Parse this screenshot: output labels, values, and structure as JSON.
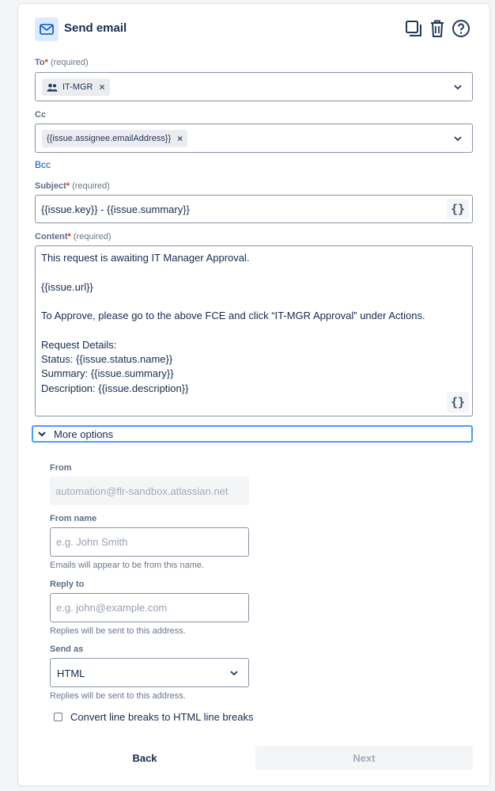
{
  "header": {
    "title": "Send email"
  },
  "icons": [
    "mail-icon",
    "duplicate-icon",
    "trash-icon",
    "help-icon",
    "people-icon",
    "chevron-down-icon",
    "smart-values-icon",
    "checkbox-icon"
  ],
  "to": {
    "label": "To",
    "required_text": "(required)",
    "tag": "IT-MGR",
    "remove": "×"
  },
  "cc": {
    "label": "Cc",
    "tag": "{{issue.assignee.emailAddress}}",
    "remove": "×"
  },
  "bcc_link": "Bcc",
  "subject": {
    "label": "Subject",
    "required_text": "(required)",
    "value": "{{issue.key}} - {{issue.summary}}",
    "smart_btn": "{}"
  },
  "content": {
    "label": "Content",
    "required_text": "(required)",
    "value": "This request is awaiting IT Manager Approval.\n\n{{issue.url}}\n\nTo Approve, please go to the above FCE and click “IT-MGR Approval” under Actions.\n\nRequest Details:\nStatus: {{issue.status.name}}\nSummary: {{issue.summary}}\nDescription: {{issue.description}}",
    "smart_btn": "{}"
  },
  "more_options": {
    "label": "More options"
  },
  "from": {
    "label": "From",
    "value": "automation@flr-sandbox.atlassian.net"
  },
  "from_name": {
    "label": "From name",
    "placeholder": "e.g. John Smith",
    "helper": "Emails will appear to be from this name."
  },
  "reply_to": {
    "label": "Reply to",
    "placeholder": "e.g. john@example.com",
    "helper": "Replies will be sent to this address."
  },
  "send_as": {
    "label": "Send as",
    "value": "HTML",
    "helper": "Replies will be sent to this address."
  },
  "convert_breaks": {
    "label": "Convert line breaks to HTML line breaks",
    "checked": false
  },
  "footer": {
    "back": "Back",
    "next": "Next"
  },
  "colors": {
    "accent": "#0052cc",
    "focus": "#4c9aff",
    "required": "#de350b"
  }
}
